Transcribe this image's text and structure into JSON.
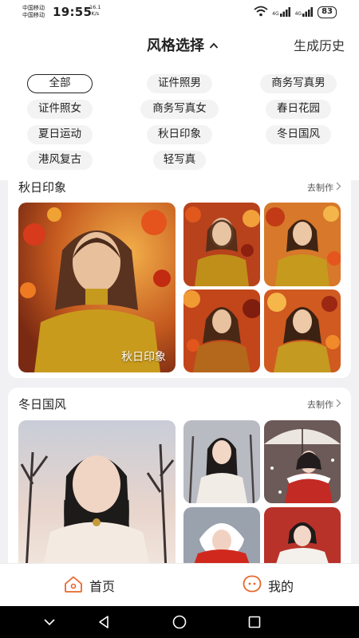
{
  "status_bar": {
    "carrier_line1": "中国移动",
    "carrier_line2": "中国移动",
    "time": "19:55",
    "net_speed_value": "16.1",
    "net_speed_unit": "K/s",
    "signal_1": "4G",
    "signal_2": "4G",
    "battery": "83"
  },
  "header": {
    "title": "风格选择",
    "history_link": "生成历史"
  },
  "chips": [
    {
      "label": "全部",
      "active": true
    },
    {
      "label": "证件照男"
    },
    {
      "label": "商务写真男"
    },
    {
      "label": "证件照女"
    },
    {
      "label": "商务写真女"
    },
    {
      "label": "春日花园"
    },
    {
      "label": "夏日运动"
    },
    {
      "label": "秋日印象"
    },
    {
      "label": "冬日国风"
    },
    {
      "label": "港风复古"
    },
    {
      "label": "轻写真"
    }
  ],
  "sections": [
    {
      "title": "秋日印象",
      "action": "去制作",
      "cover_caption": "秋日印象"
    },
    {
      "title": "冬日国风",
      "action": "去制作"
    }
  ],
  "tabbar": {
    "home": "首页",
    "mine": "我的",
    "accent": "#e8672c"
  },
  "icons": [
    "wifi-icon",
    "signal-icon",
    "chevron-up-icon",
    "chevron-right-icon",
    "home-icon",
    "smile-face-icon",
    "back-icon",
    "home-circle-icon",
    "recents-icon"
  ]
}
